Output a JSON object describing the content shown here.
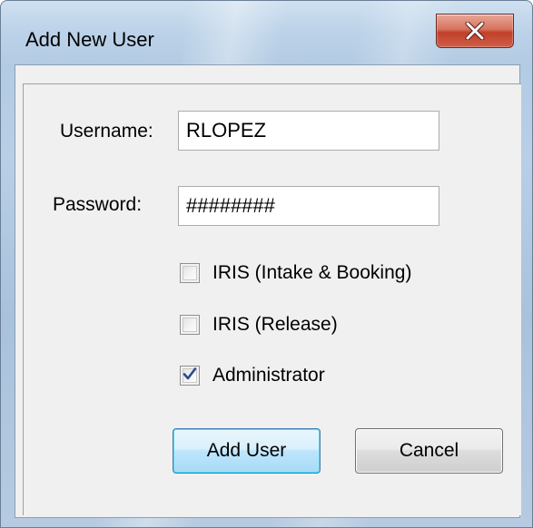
{
  "window": {
    "title": "Add New User",
    "close_glyph": "X"
  },
  "form": {
    "username_label": "Username:",
    "username_value": "RLOPEZ",
    "password_label": "Password:",
    "password_value": "########",
    "checkboxes": [
      {
        "label": "IRIS (Intake & Booking)",
        "checked": false
      },
      {
        "label": "IRIS (Release)",
        "checked": false
      },
      {
        "label": "Administrator",
        "checked": true
      }
    ]
  },
  "buttons": {
    "add_label": "Add User",
    "cancel_label": "Cancel"
  },
  "icons": {
    "close": "close-icon",
    "check": "checkmark-icon"
  },
  "colors": {
    "close_button": "#c1402a",
    "default_button_border": "#3c7fb1",
    "checkmark": "#2b4a8c"
  }
}
